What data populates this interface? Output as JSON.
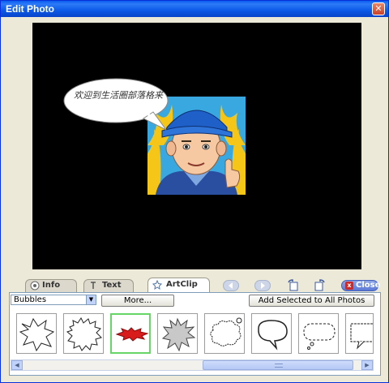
{
  "window": {
    "title": "Edit Photo",
    "close_glyph": "✕"
  },
  "canvas": {
    "bubble_text": "欢迎到生活圈部落格来"
  },
  "tabs": [
    {
      "label": "Info",
      "icon": "info-icon"
    },
    {
      "label": "Text",
      "icon": "text-icon"
    },
    {
      "label": "ArtClip",
      "icon": "artclip-icon"
    }
  ],
  "toolbar": {
    "close_label": "Close",
    "close_glyph": "x"
  },
  "artclip": {
    "category": "Bubbles",
    "more_label": "More...",
    "add_all_label": "Add Selected to All Photos"
  },
  "scroll": {
    "left_glyph": "◀",
    "right_glyph": "▶"
  }
}
